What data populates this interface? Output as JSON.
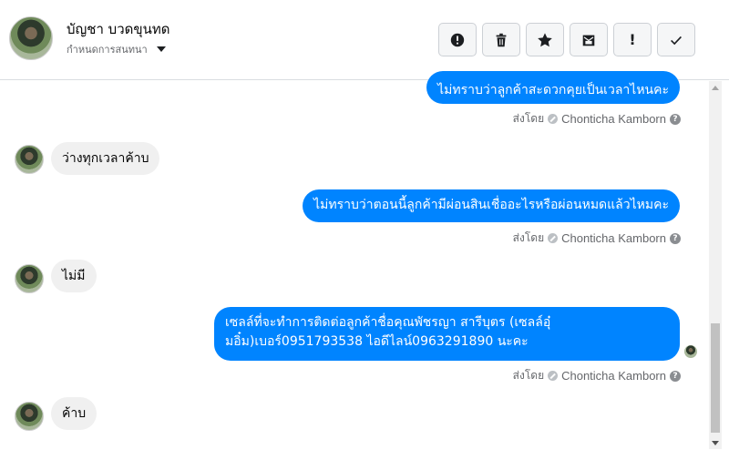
{
  "header": {
    "contact_name": "บัญชา บวดขุนทด",
    "subtitle": "กำหนดการสนทนา",
    "toolbar": [
      {
        "name": "report-spam-button",
        "icon": "alert-circle-icon"
      },
      {
        "name": "delete-button",
        "icon": "trash-icon"
      },
      {
        "name": "star-button",
        "icon": "star-icon"
      },
      {
        "name": "mark-unread-button",
        "icon": "envelope-icon"
      },
      {
        "name": "important-button",
        "icon": "exclamation-icon",
        "glyph": "!"
      },
      {
        "name": "done-button",
        "icon": "check-icon"
      }
    ]
  },
  "messages": [
    {
      "direction": "out",
      "text": "ไม่ทราบว่าลูกค้าสะดวกคุยเป็นเวลาไหนคะ",
      "sent_by_label": "ส่งโดย",
      "sender": "Chonticha Kamborn"
    },
    {
      "direction": "in",
      "text": "ว่างทุกเวลาค้าบ"
    },
    {
      "direction": "out",
      "text": "ไม่ทราบว่าตอนนี้ลูกค้ามีผ่อนสินเชื่ออะไรหรือผ่อนหมดแล้วไหมคะ",
      "sent_by_label": "ส่งโดย",
      "sender": "Chonticha Kamborn"
    },
    {
      "direction": "in",
      "text": "ไม่มี"
    },
    {
      "direction": "out",
      "text": "เซลล์ที่จะทำการติดต่อลูกค้าชื่อคุณพัชรญา สารีบุตร (เซลล์อุ๋มอิ๋ม)เบอร์0951793538 ไอดีไลน์0963291890  นะคะ",
      "sent_by_label": "ส่งโดย",
      "sender": "Chonticha Kamborn"
    },
    {
      "direction": "in",
      "text": "ค้าบ"
    }
  ],
  "colors": {
    "outgoing_bubble": "#0084ff",
    "incoming_bubble": "#f0f0f0"
  }
}
